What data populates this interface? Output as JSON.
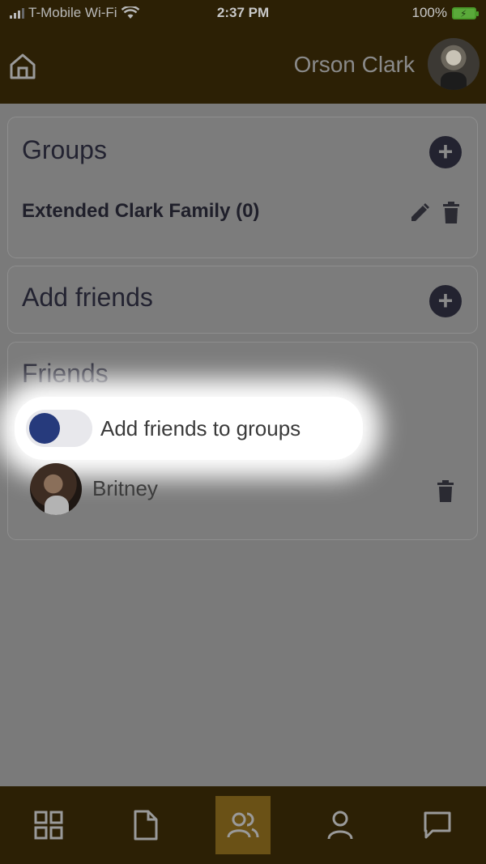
{
  "status_bar": {
    "carrier": "T-Mobile Wi-Fi",
    "time": "2:37 PM",
    "battery": "100%"
  },
  "header": {
    "user_name": "Orson Clark",
    "home_icon": "home-icon",
    "avatar_icon": "user-avatar"
  },
  "groups": {
    "title": "Groups",
    "items": [
      {
        "label": "Extended Clark Family (0)"
      }
    ]
  },
  "add_friends": {
    "title": "Add friends"
  },
  "friends": {
    "title": "Friends",
    "toggle_label": "Add friends to groups",
    "toggle_on": false,
    "items": [
      {
        "name": "Britney"
      }
    ]
  },
  "tab_bar": {
    "tabs": [
      {
        "icon": "grid-icon",
        "active": false
      },
      {
        "icon": "document-icon",
        "active": false
      },
      {
        "icon": "friends-icon",
        "active": true
      },
      {
        "icon": "profile-icon",
        "active": false
      },
      {
        "icon": "chat-icon",
        "active": false
      }
    ]
  },
  "colors": {
    "header_bg": "#2c2005",
    "overlay_bg": "#7a7a7a",
    "toggle_knob": "#263a7c",
    "active_tab": "#6a5116"
  }
}
